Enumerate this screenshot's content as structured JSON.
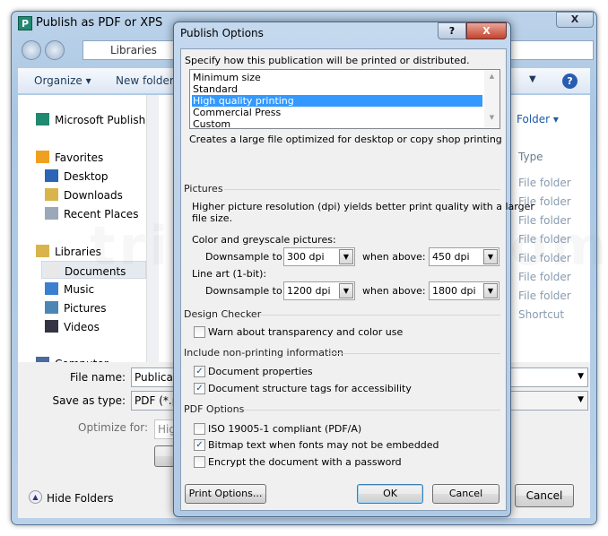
{
  "outer": {
    "title": "Publish as PDF or XPS",
    "close": "X",
    "breadcrumb": "Libraries",
    "toolbar": {
      "organize": "Organize ▾",
      "new_folder": "New folder"
    },
    "nav": [
      {
        "label": "Microsoft Publishe",
        "icon": "publisher-icon"
      },
      {
        "label": "Favorites",
        "icon": "star-icon"
      },
      {
        "label": "Desktop",
        "icon": "desktop-icon"
      },
      {
        "label": "Downloads",
        "icon": "downloads-icon"
      },
      {
        "label": "Recent Places",
        "icon": "recent-places-icon"
      },
      {
        "label": "Libraries",
        "icon": "libraries-icon"
      },
      {
        "label": "Documents",
        "icon": "documents-icon"
      },
      {
        "label": "Music",
        "icon": "music-icon"
      },
      {
        "label": "Pictures",
        "icon": "pictures-icon"
      },
      {
        "label": "Videos",
        "icon": "videos-icon"
      },
      {
        "label": "Computer",
        "icon": "computer-icon"
      }
    ],
    "arrange": "Folder ▾",
    "column_type": "Type",
    "types": [
      "File folder",
      "File folder",
      "File folder",
      "File folder",
      "File folder",
      "File folder",
      "File folder",
      "Shortcut"
    ],
    "file_name_label": "File name:",
    "file_name_value": "Publicat",
    "save_type_label": "Save as type:",
    "save_type_value": "PDF (*.p",
    "optimize_label": "Optimize for:",
    "optimize_value": "Hig",
    "hide_folders": "Hide Folders",
    "cancel": "Cancel"
  },
  "dialog": {
    "title": "Publish Options",
    "help": "?",
    "close": "X",
    "intro": "Specify how this publication will be printed or distributed.",
    "options": [
      "Minimum size",
      "Standard",
      "High quality printing",
      "Commercial Press",
      "Custom"
    ],
    "selected_option": "High quality printing",
    "option_desc": "Creates a large file optimized for desktop or copy shop printing",
    "pictures": {
      "heading": "Pictures",
      "desc1": "Higher picture resolution (dpi) yields better print quality with a larger",
      "desc2": "file size.",
      "color_label": "Color and greyscale pictures:",
      "line_label": "Line art (1-bit):",
      "downsample_label": "Downsample to:",
      "when_label": "when above:",
      "color_down": "300 dpi",
      "color_above": "450 dpi",
      "line_down": "1200 dpi",
      "line_above": "1800 dpi"
    },
    "design_checker": {
      "heading": "Design Checker",
      "warn": "Warn about transparency and color use",
      "warn_checked": false
    },
    "nonprinting": {
      "heading": "Include non-printing information",
      "props": "Document properties",
      "props_checked": true,
      "tags": "Document structure tags for accessibility",
      "tags_checked": true
    },
    "pdf": {
      "heading": "PDF Options",
      "iso": "ISO 19005-1 compliant (PDF/A)",
      "iso_checked": false,
      "bitmap": "Bitmap text when fonts may not be embedded",
      "bitmap_checked": true,
      "encrypt": "Encrypt the document with a password",
      "encrypt_checked": false
    },
    "buttons": {
      "print_options": "Print Options...",
      "ok": "OK",
      "cancel": "Cancel"
    }
  },
  "colors": {
    "selection": "#3399ff",
    "frame": "#b9d1e9"
  }
}
